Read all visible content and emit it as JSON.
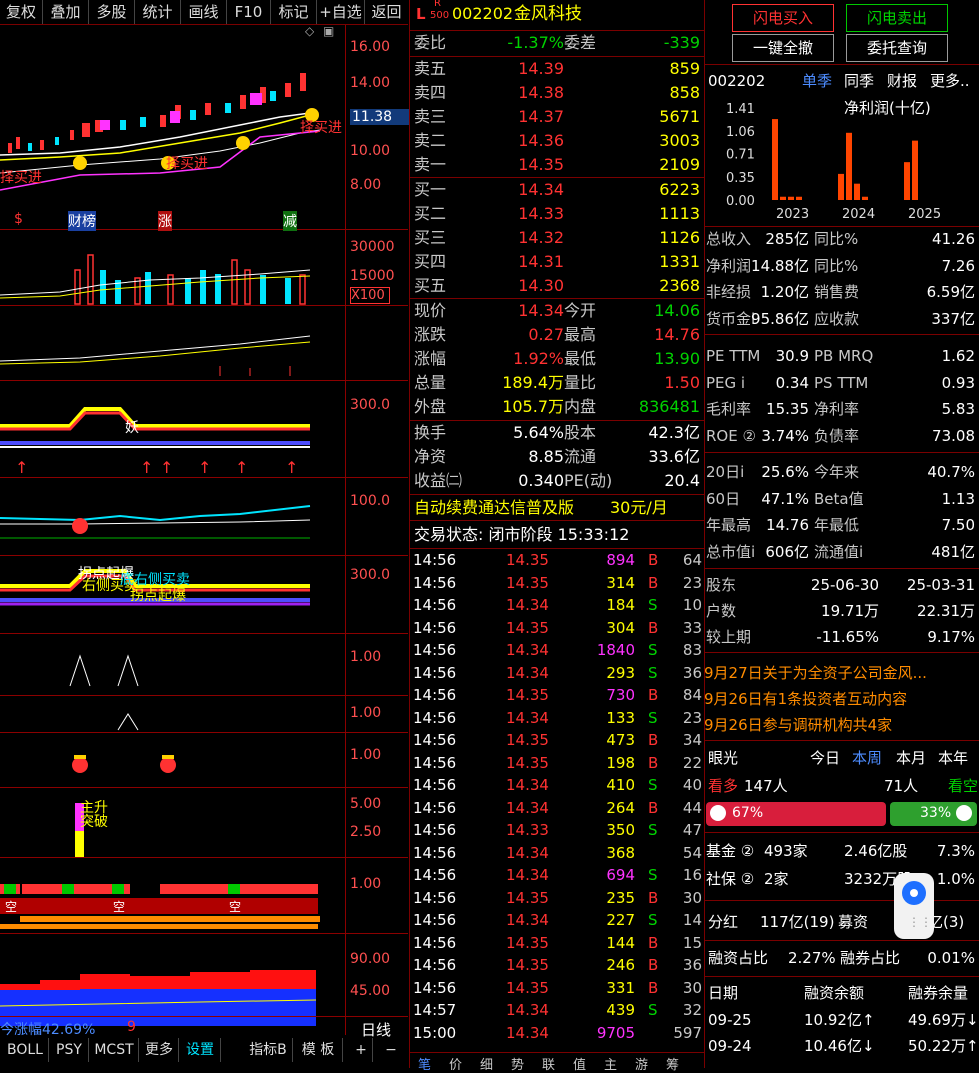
{
  "toolbar": [
    "复权",
    "叠加",
    "多股",
    "统计",
    "画线",
    "F10",
    "标记",
    "+自选",
    "返回"
  ],
  "chart": {
    "price_scale": [
      "16.00",
      "14.00",
      "11.38",
      "10.00",
      "8.00"
    ],
    "vol_scale": [
      "30000",
      "15000",
      "X100"
    ],
    "ind_scales": [
      "300.0",
      "100.0",
      "300.0",
      "1.00",
      "1.00",
      "1.00",
      "5.00",
      "2.50",
      "1.00",
      "90.00",
      "45.00"
    ],
    "markers": [
      "$",
      "财榜",
      "涨",
      "减"
    ],
    "annotations": [
      "择买进",
      "择买进",
      "择买进",
      "妖",
      "拐点起爆",
      "右侧买卖",
      "底右侧买卖",
      "拐点起爆",
      "主升",
      "突破"
    ],
    "pct_label": "今涨幅42.69%",
    "pct_value": "9",
    "period_label": "日线",
    "kong": "空"
  },
  "bottom_tabs": [
    "BOLL",
    "PSY",
    "MCST",
    "更多",
    "设置",
    "指标B",
    "模 板",
    "+",
    "−"
  ],
  "stock": {
    "prefix": "L",
    "badge_top": "R",
    "badge_bottom": "500",
    "code": "002202",
    "name": "金风科技",
    "weibi_label": "委比",
    "weibi_value": "-1.37%",
    "weicha_label": "委差",
    "weicha_value": "-339",
    "sells": [
      {
        "label": "卖五",
        "price": "14.39",
        "vol": "859"
      },
      {
        "label": "卖四",
        "price": "14.38",
        "vol": "858"
      },
      {
        "label": "卖三",
        "price": "14.37",
        "vol": "5671"
      },
      {
        "label": "卖二",
        "price": "14.36",
        "vol": "3003"
      },
      {
        "label": "卖一",
        "price": "14.35",
        "vol": "2109"
      }
    ],
    "buys": [
      {
        "label": "买一",
        "price": "14.34",
        "vol": "6223"
      },
      {
        "label": "买二",
        "price": "14.33",
        "vol": "1113"
      },
      {
        "label": "买三",
        "price": "14.32",
        "vol": "1126"
      },
      {
        "label": "买四",
        "price": "14.31",
        "vol": "1331"
      },
      {
        "label": "买五",
        "price": "14.30",
        "vol": "2368"
      }
    ],
    "quote": [
      {
        "l1": "现价",
        "v1": "14.34",
        "l2": "今开",
        "v2": "14.06"
      },
      {
        "l1": "涨跌",
        "v1": "0.27",
        "l2": "最高",
        "v2": "14.76"
      },
      {
        "l1": "涨幅",
        "v1": "1.92%",
        "l2": "最低",
        "v2": "13.90"
      },
      {
        "l1": "总量",
        "v1": "189.4万",
        "l2": "量比",
        "v2": "1.50"
      },
      {
        "l1": "外盘",
        "v1": "105.7万",
        "l2": "内盘",
        "v2": "836481"
      }
    ],
    "quote2": [
      {
        "l1": "换手",
        "v1": "5.64%",
        "l2": "股本",
        "v2": "42.3亿"
      },
      {
        "l1": "净资",
        "v1": "8.85",
        "l2": "流通",
        "v2": "33.6亿"
      },
      {
        "l1": "收益㈡",
        "v1": "0.340",
        "l2": "PE(动)",
        "v2": "20.4"
      }
    ],
    "promo_left": "自动续费通达信普及版",
    "promo_right": "30元/月",
    "trade_status": "交易状态: 闭市阶段 15:33:12"
  },
  "ticks": [
    [
      "14:56",
      "14.35",
      "894",
      "B",
      "64"
    ],
    [
      "14:56",
      "14.35",
      "314",
      "B",
      "23"
    ],
    [
      "14:56",
      "14.34",
      "184",
      "S",
      "10"
    ],
    [
      "14:56",
      "14.35",
      "304",
      "B",
      "33"
    ],
    [
      "14:56",
      "14.34",
      "1840",
      "S",
      "83"
    ],
    [
      "14:56",
      "14.34",
      "293",
      "S",
      "36"
    ],
    [
      "14:56",
      "14.35",
      "730",
      "B",
      "84"
    ],
    [
      "14:56",
      "14.34",
      "133",
      "S",
      "23"
    ],
    [
      "14:56",
      "14.35",
      "473",
      "B",
      "34"
    ],
    [
      "14:56",
      "14.35",
      "198",
      "B",
      "22"
    ],
    [
      "14:56",
      "14.34",
      "410",
      "S",
      "40"
    ],
    [
      "14:56",
      "14.34",
      "264",
      "B",
      "44"
    ],
    [
      "14:56",
      "14.33",
      "350",
      "S",
      "47"
    ],
    [
      "14:56",
      "14.34",
      "368",
      "",
      "54"
    ],
    [
      "14:56",
      "14.34",
      "694",
      "S",
      "16"
    ],
    [
      "14:56",
      "14.35",
      "235",
      "B",
      "30"
    ],
    [
      "14:56",
      "14.34",
      "227",
      "S",
      "14"
    ],
    [
      "14:56",
      "14.35",
      "144",
      "B",
      "15"
    ],
    [
      "14:56",
      "14.35",
      "246",
      "B",
      "36"
    ],
    [
      "14:56",
      "14.35",
      "331",
      "B",
      "30"
    ],
    [
      "14:57",
      "14.34",
      "439",
      "S",
      "32"
    ],
    [
      "15:00",
      "14.34",
      "9705",
      "",
      "597"
    ]
  ],
  "bottom_strip": [
    "笔",
    "价",
    "细",
    "势",
    "联",
    "值",
    "主",
    "游",
    "筹"
  ],
  "right": {
    "buttons": [
      "闪电买入",
      "闪电卖出",
      "一键全撤",
      "委托查询"
    ],
    "code": "002202",
    "tabs": [
      "单季",
      "同季",
      "财报",
      "更多.."
    ],
    "chart_title": "净利润(十亿)",
    "y_ticks": [
      "1.41",
      "1.06",
      "0.71",
      "0.35",
      "0.00"
    ],
    "years": [
      "2023",
      "2024",
      "2025"
    ],
    "chart_data": {
      "type": "bar",
      "title": "净利润(十亿)",
      "categories": [
        "2023Q1",
        "2023Q2",
        "2023Q3",
        "2023Q4",
        "2024Q1",
        "2024Q2",
        "2024Q3",
        "2024Q4",
        "2025Q1",
        "2025Q2"
      ],
      "values": [
        1.24,
        0.05,
        0.05,
        0.05,
        0.4,
        1.03,
        0.25,
        0.05,
        0.58,
        0.91
      ],
      "ylim": [
        0,
        1.41
      ]
    },
    "fin": [
      [
        "总收入",
        "285亿",
        "同比%",
        "41.26"
      ],
      [
        "净利润",
        "14.88亿",
        "同比%",
        "7.26"
      ],
      [
        "非经损",
        "1.20亿",
        "销售费",
        "6.59亿"
      ],
      [
        "货币金i",
        "95.86亿",
        "应收款",
        "337亿"
      ]
    ],
    "val": [
      [
        "PE TTM",
        "30.9",
        "PB MRQ",
        "1.62"
      ],
      [
        "PEG i",
        "0.34",
        "PS TTM",
        "0.93"
      ],
      [
        "毛利率",
        "15.35",
        "净利率",
        "5.83"
      ],
      [
        "ROE ②",
        "3.74%",
        "负债率",
        "73.08"
      ]
    ],
    "perf": [
      [
        "20日i",
        "25.6%",
        "今年来",
        "40.7%"
      ],
      [
        "60日",
        "47.1%",
        "Beta值",
        "1.13"
      ],
      [
        "年最高",
        "14.76",
        "年最低",
        "7.50"
      ],
      [
        "总市值i",
        "606亿",
        "流通值i",
        "481亿"
      ]
    ],
    "holders": [
      [
        "股东",
        "25-06-30",
        "25-03-31"
      ],
      [
        "户数",
        "19.71万",
        "22.31万"
      ],
      [
        "较上期",
        "-11.65%",
        "9.17%"
      ]
    ],
    "news": [
      "9月27日关于为全资子公司金风...",
      "9月26日有1条投资者互动内容",
      "9月26日参与调研机构共4家"
    ],
    "vision": {
      "label": "眼光",
      "tabs": [
        "今日",
        "本周",
        "本月",
        "本年"
      ],
      "bull_label": "看多",
      "bull_count": "147人",
      "bear_count": "71人",
      "bear_label": "看空",
      "bull_pct": "67%",
      "bear_pct": "33%"
    },
    "funds": [
      [
        "基金 ②",
        "493家",
        "2.46亿股",
        "7.3%"
      ],
      [
        "社保 ②",
        "2家",
        "3232万股",
        "1.0%"
      ]
    ],
    "dividend": [
      "分红",
      "117亿(19)",
      "募资",
      "亿(3)"
    ],
    "margin": [
      "融资占比",
      "2.27%",
      "融券占比",
      "0.01%"
    ],
    "margin_head": [
      "日期",
      "融资余额",
      "融券余量"
    ],
    "margin_rows": [
      [
        "09-25",
        "10.92亿↑",
        "49.69万↓"
      ],
      [
        "09-24",
        "10.46亿↓",
        "50.22万↑"
      ]
    ]
  }
}
